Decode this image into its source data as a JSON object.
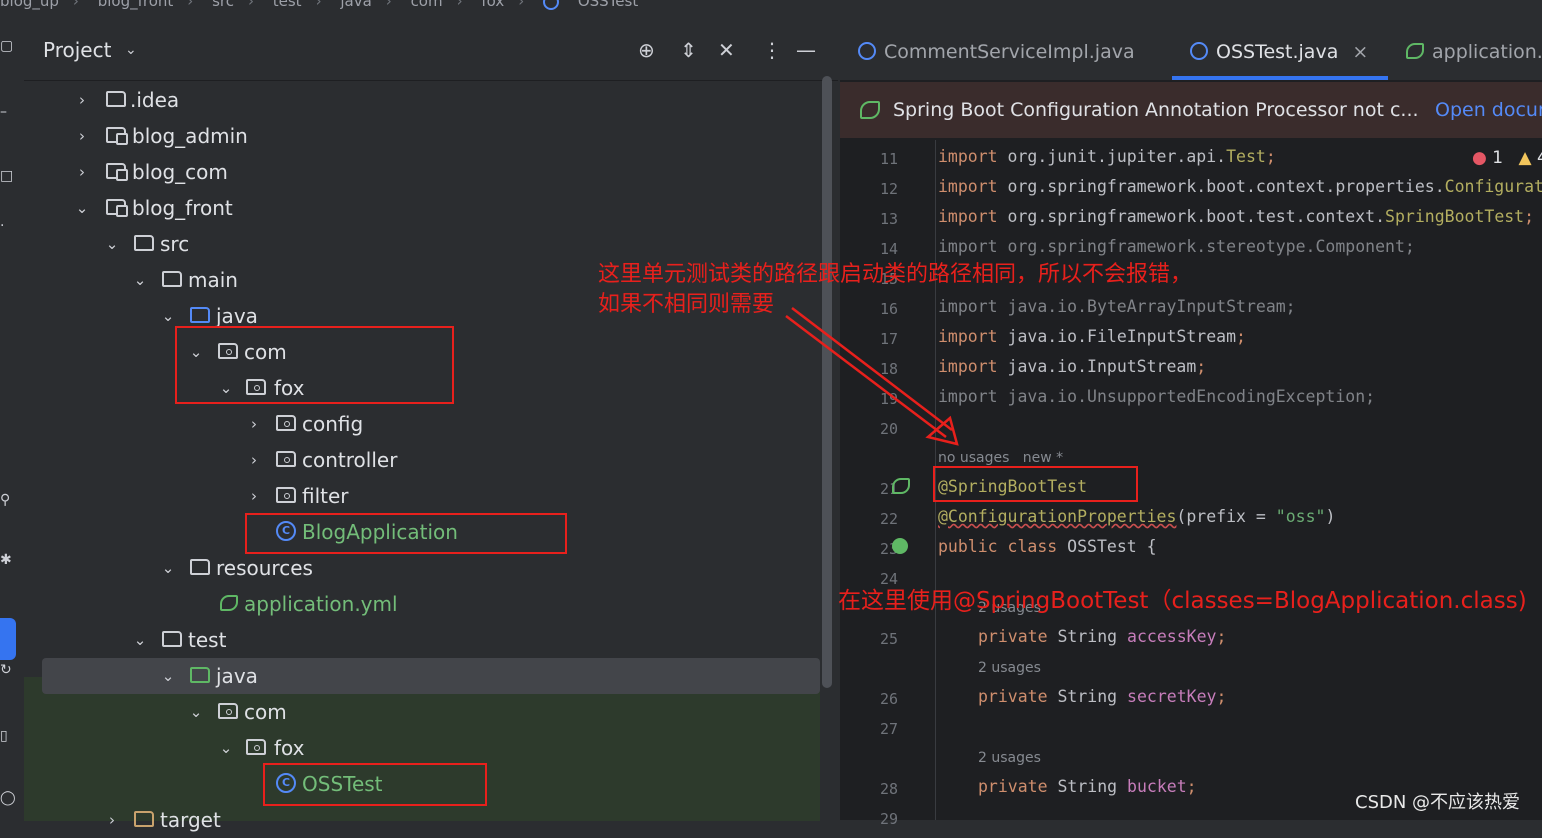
{
  "breadcrumb": [
    "blog_up",
    "blog_front",
    "src",
    "test",
    "java",
    "com",
    "fox",
    "OSSTest"
  ],
  "project_panel": {
    "title": "Project",
    "tree": [
      {
        "label": ".idea"
      },
      {
        "label": "blog_admin"
      },
      {
        "label": "blog_com"
      },
      {
        "label": "blog_front"
      },
      {
        "label": "src"
      },
      {
        "label": "main"
      },
      {
        "label": "java"
      },
      {
        "label": "com"
      },
      {
        "label": "fox"
      },
      {
        "label": "config"
      },
      {
        "label": "controller"
      },
      {
        "label": "filter"
      },
      {
        "label": "BlogApplication"
      },
      {
        "label": "resources"
      },
      {
        "label": "application.yml"
      },
      {
        "label": "test"
      },
      {
        "label": "java"
      },
      {
        "label": "com"
      },
      {
        "label": "fox"
      },
      {
        "label": "OSSTest"
      },
      {
        "label": "target"
      }
    ]
  },
  "editor": {
    "tabs": [
      {
        "label": "CommentServiceImpl.java"
      },
      {
        "label": "OSSTest.java"
      },
      {
        "label": "application."
      }
    ],
    "close_glyph": "×",
    "banner": {
      "message": "Spring Boot Configuration Annotation Processor not c...",
      "action": "Open docur"
    },
    "problems": {
      "errors": "1",
      "warnings": "4"
    },
    "line_numbers": [
      "11",
      "12",
      "13",
      "14",
      "15",
      "16",
      "17",
      "18",
      "19",
      "20",
      "21",
      "22",
      "23",
      "24",
      "25",
      "26",
      "27",
      "28",
      "29"
    ],
    "code": {
      "l11_pkg": "org.junit.jupiter.api.",
      "l11_cls": "Test",
      "l12_pkg": "org.springframework.boot.context.properties.",
      "l12_cls": "Configurat",
      "l13_pkg": "org.springframework.boot.test.context.",
      "l13_cls": "SpringBootTest",
      "l14": "import org.springframework.stereotype.Component;",
      "l16": "import java.io.ByteArrayInputStream;",
      "l17": "java.io.FileInputStream",
      "l18": "java.io.InputStream",
      "l19": "import java.io.UnsupportedEncodingException;",
      "import_kw": "import",
      "semicolon": ";",
      "hint_no_usages": "no usages",
      "hint_new": "new *",
      "l21": "@SpringBootTest",
      "l22_ann": "@ConfigurationProperties",
      "l22_open": "(prefix = ",
      "l22_str": "\"oss\"",
      "l22_close": ")",
      "l23_kw": "public class",
      "l23_rest": " OSSTest {",
      "hint_2usages": "2 usages",
      "private_kw": "private",
      "type_string": " String ",
      "f_access": "accessKey",
      "f_secret": "secretKey",
      "f_bucket": "bucket"
    }
  },
  "annotations": {
    "note_line1": "这里单元测试类的路径跟启动类的路径相同，所以不会报错，",
    "note_line2": "如果不相同则需要",
    "note_bottom": "在这里使用@SpringBootTest（classes=BlogApplication.class)"
  },
  "watermark": "CSDN @不应该热爱",
  "colors": {
    "annotation_red": "#e8201c",
    "accent_blue": "#3574f0",
    "spring_green": "#5fb865",
    "keyword_orange": "#cf8e6d",
    "field_purple": "#c77dbb"
  }
}
